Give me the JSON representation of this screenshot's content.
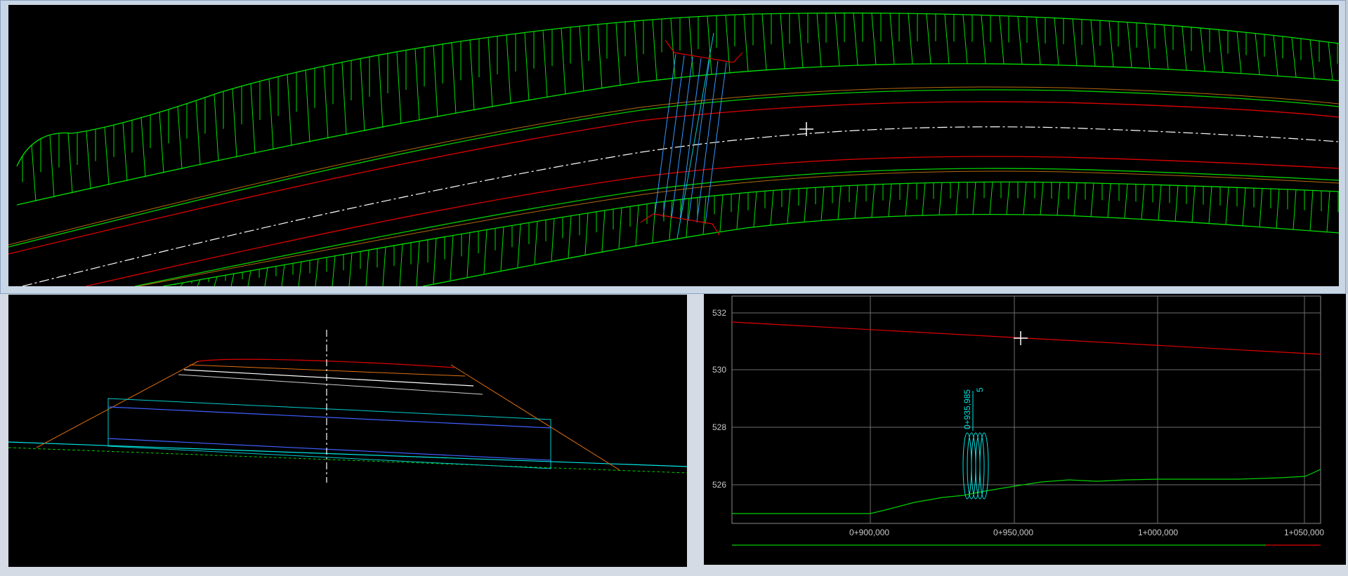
{
  "colors": {
    "background": "#000000",
    "slope": "#00e000",
    "edge_green": "#00d000",
    "edge_red": "#e00000",
    "centerline": "#ffffff",
    "culvert": "#3399ff",
    "cyan": "#00e5e5",
    "orange": "#e07010",
    "grid": "#8a8a8a",
    "crosshair": "#ffffff"
  },
  "plan_view": {
    "icons": [
      "crosshair-cursor-icon"
    ]
  },
  "section_view": {
    "icons": [
      "axis-marker-icon"
    ]
  },
  "profile_view": {
    "y_ticks": [
      "532",
      "530",
      "528",
      "526"
    ],
    "x_ticks": [
      "0+900,000",
      "0+950,000",
      "1+000,000",
      "1+050,000"
    ],
    "structure_station": "0+935,985",
    "structure_label": "5",
    "icons": [
      "crosshair-cursor-icon"
    ]
  }
}
